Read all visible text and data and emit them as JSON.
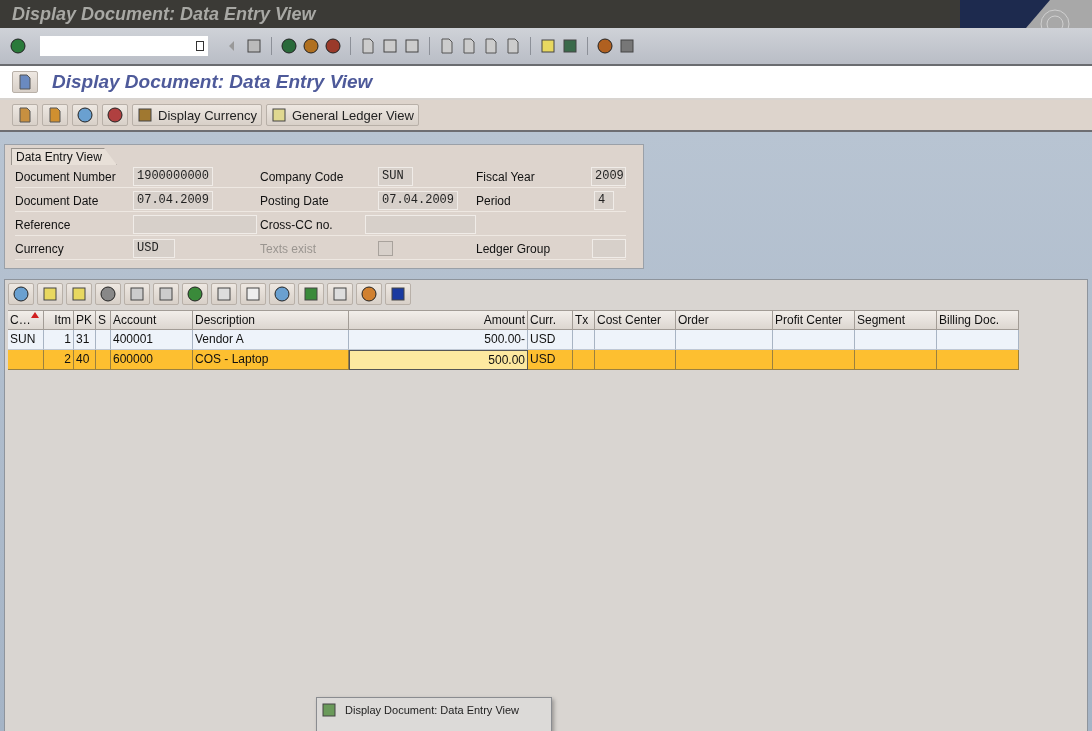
{
  "window": {
    "title": "Display Document: Data Entry View"
  },
  "header": {
    "title": "Display Document: Data Entry View"
  },
  "app_toolbar": {
    "buttons": [
      {
        "label": "Display Currency"
      },
      {
        "label": "General Ledger View"
      }
    ]
  },
  "data_entry": {
    "title": "Data Entry View",
    "fields": [
      {
        "label": "Document Number",
        "value": "1900000000",
        "kind": "field",
        "disabled": false
      },
      {
        "label": "Company Code",
        "value": "SUN",
        "kind": "field",
        "disabled": false
      },
      {
        "label": "Fiscal Year",
        "value": "2009",
        "kind": "field",
        "disabled": false
      },
      {
        "label": "Document Date",
        "value": "07.04.2009",
        "kind": "field",
        "disabled": false
      },
      {
        "label": "Posting Date",
        "value": "07.04.2009",
        "kind": "field",
        "disabled": false
      },
      {
        "label": "Period",
        "value": "4",
        "kind": "field",
        "disabled": false
      },
      {
        "label": "Reference",
        "kind": "field",
        "disabled": false
      },
      {
        "label": "Cross-CC no.",
        "kind": "field",
        "disabled": false
      },
      {
        "kind": "empty"
      },
      {
        "label": "Currency",
        "value": "USD",
        "kind": "field",
        "disabled": false
      },
      {
        "label": "Texts exist",
        "kind": "checkbox",
        "checked": false,
        "disabled": true
      },
      {
        "label": "Ledger Group",
        "kind": "field",
        "disabled": false
      }
    ]
  },
  "table": {
    "columns": [
      {
        "label": "C…",
        "sorted": true
      },
      {
        "label": "Itm",
        "sorted": false
      },
      {
        "label": "PK",
        "sorted": false
      },
      {
        "label": "S",
        "sorted": false
      },
      {
        "label": "Account",
        "sorted": false
      },
      {
        "label": "Description",
        "sorted": false
      },
      {
        "label": "Amount",
        "sorted": false
      },
      {
        "label": "Curr.",
        "sorted": false
      },
      {
        "label": "Tx",
        "sorted": false
      },
      {
        "label": "Cost Center",
        "sorted": false
      },
      {
        "label": "Order",
        "sorted": false
      },
      {
        "label": "Profit Center",
        "sorted": false
      },
      {
        "label": "Segment",
        "sorted": false
      },
      {
        "label": "Billing Doc.",
        "sorted": false
      }
    ],
    "rows": [
      {
        "selected": false,
        "cells": [
          "SUN",
          "1",
          "31",
          "",
          "400001",
          "Vendor A",
          "500.00-",
          "USD",
          "",
          "",
          "",
          "",
          "",
          ""
        ]
      },
      {
        "selected": true,
        "cells": [
          "",
          "2",
          "40",
          "",
          "600000",
          "COS - Laptop",
          "500.00",
          "USD",
          "",
          "",
          "",
          "",
          "",
          ""
        ]
      }
    ]
  },
  "popup": {
    "items": [
      "Display Document: Data Entry View"
    ]
  }
}
